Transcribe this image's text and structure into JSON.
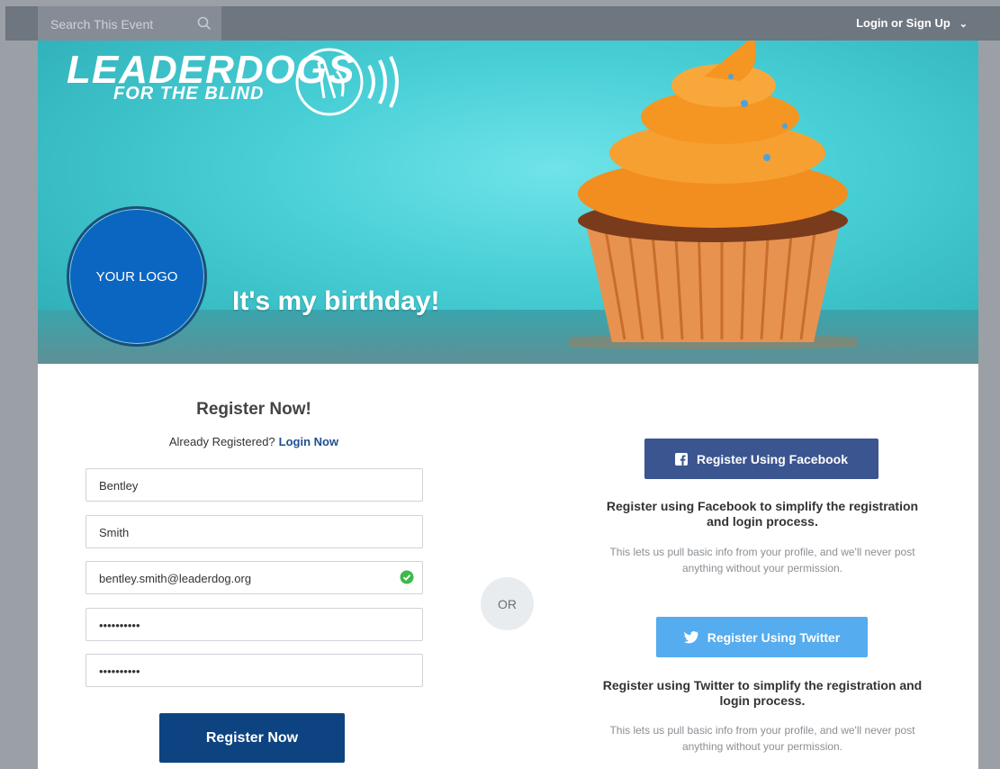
{
  "header": {
    "search_placeholder": "Search This Event",
    "login_label": "Login or Sign Up"
  },
  "hero": {
    "brand_name": "LEADERDOGS",
    "brand_sub": "FOR THE BLIND",
    "logo_text": "YOUR LOGO",
    "headline": "It's my birthday!"
  },
  "register": {
    "title": "Register Now!",
    "already_text": "Already Registered?",
    "login_link": "Login Now",
    "fields": {
      "first_name": "Bentley",
      "last_name": "Smith",
      "email": "bentley.smith@leaderdog.org",
      "password": "••••••••••",
      "confirm_password": "••••••••••"
    },
    "submit_label": "Register Now"
  },
  "or_label": "OR",
  "social": {
    "facebook_label": "Register Using Facebook",
    "facebook_promo": "Register using Facebook to simplify the registration and login process.",
    "facebook_note": "This lets us pull basic info from your profile, and we'll never post anything without your permission.",
    "twitter_label": "Register Using Twitter",
    "twitter_promo": "Register using Twitter to simplify the registration and login process.",
    "twitter_note": "This lets us pull basic info from your profile, and we'll never post anything without your permission."
  },
  "colors": {
    "topbar": "#6e7680",
    "hero_teal": "#48cfd6",
    "primary_button": "#0e4381",
    "facebook": "#3b5590",
    "twitter": "#55acee",
    "logo_circle": "#0b66c2"
  }
}
